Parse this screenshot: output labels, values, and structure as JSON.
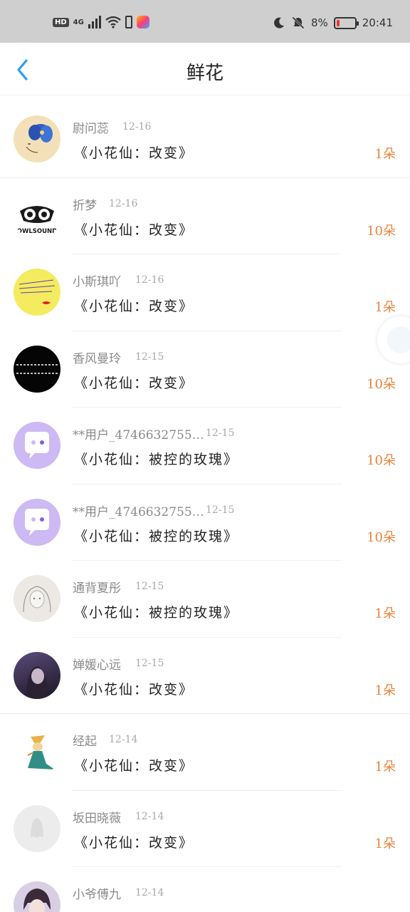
{
  "status_bar": {
    "hd": "HD",
    "network": "4G",
    "battery_text": "8%",
    "time": "20:41",
    "icons": [
      "hd-icon",
      "signal-icon",
      "wifi-icon",
      "phone-battery-icon",
      "app-notification-icon",
      "moon-icon",
      "mute-icon",
      "battery-icon"
    ]
  },
  "header": {
    "title": "鲜花",
    "back_icon": "chevron-left-icon"
  },
  "colors": {
    "accent": "#2a9df4",
    "count": "#e8833a",
    "name": "#8a8a8a",
    "status_bar_bg": "#cfcfcf"
  },
  "rows": [
    {
      "name": "尉问蕊",
      "date": "12-16",
      "work": "《小花仙：改变》",
      "count": "1朵",
      "avatar": "blue-flower-girl-avatar"
    },
    {
      "name": "折梦",
      "date": "12-16",
      "work": "《小花仙：改变》",
      "count": "10朵",
      "avatar": "owlsound-logo-avatar",
      "logo_text": "OWLSOUND"
    },
    {
      "name": "小斯琪吖",
      "date": "12-16",
      "work": "《小花仙：改变》",
      "count": "1朵",
      "avatar": "yellow-note-avatar"
    },
    {
      "name": "香风曼玲",
      "date": "12-15",
      "work": "《小花仙：改变》",
      "count": "10朵",
      "avatar": "black-text-avatar"
    },
    {
      "name": "**用户_4746632755…",
      "date": "12-15",
      "work": "《小花仙：被控的玫瑰》",
      "count": "10朵",
      "avatar": "purple-chat-avatar"
    },
    {
      "name": "**用户_4746632755…",
      "date": "12-15",
      "work": "《小花仙：被控的玫瑰》",
      "count": "10朵",
      "avatar": "purple-chat-avatar"
    },
    {
      "name": "通背夏彤",
      "date": "12-15",
      "work": "《小花仙：被控的玫瑰》",
      "count": "1朵",
      "avatar": "sketch-girl-avatar"
    },
    {
      "name": "婵媛心远",
      "date": "12-15",
      "work": "《小花仙：改变》",
      "count": "1朵",
      "avatar": "dark-portrait-avatar"
    },
    {
      "name": "经起",
      "date": "12-14",
      "work": "《小花仙：改变》",
      "count": "1朵",
      "avatar": "figure-avatar"
    },
    {
      "name": "坂田晓薇",
      "date": "12-14",
      "work": "《小花仙：改变》",
      "count": "1朵",
      "avatar": "default-gray-avatar"
    },
    {
      "name": "小爷傅九",
      "date": "12-14",
      "work": "",
      "count": "",
      "avatar": "anime-boy-avatar"
    }
  ]
}
